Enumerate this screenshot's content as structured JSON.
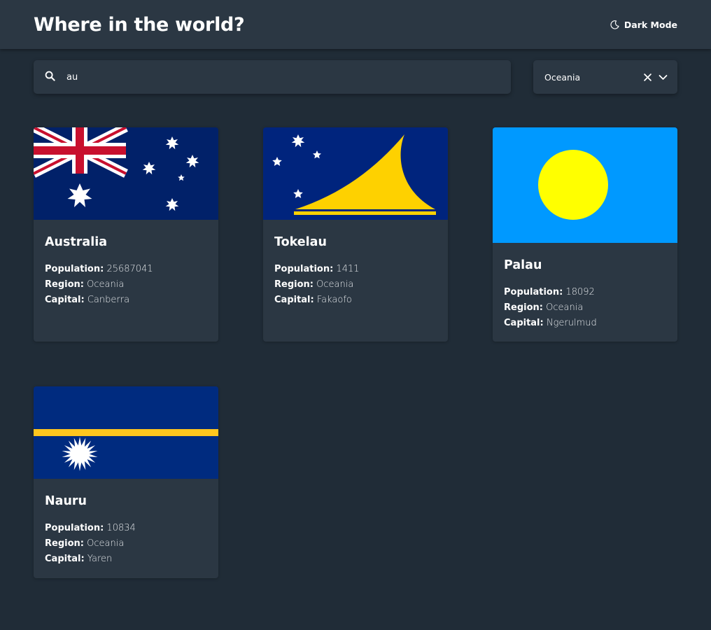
{
  "header": {
    "title": "Where in the world?",
    "theme_toggle_label": "Dark Mode",
    "theme_icon": "moon-icon"
  },
  "search": {
    "value": "au",
    "icon": "search-icon"
  },
  "filter": {
    "selected": "Oceania",
    "clear_icon": "close-icon",
    "chevron_icon": "chevron-down-icon"
  },
  "labels": {
    "population": "Population:",
    "region": "Region:",
    "capital": "Capital:"
  },
  "countries": [
    {
      "name": "Australia",
      "population": "25687041",
      "region": "Oceania",
      "capital": "Canberra",
      "flag": "australia-flag"
    },
    {
      "name": "Tokelau",
      "population": "1411",
      "region": "Oceania",
      "capital": "Fakaofo",
      "flag": "tokelau-flag"
    },
    {
      "name": "Palau",
      "population": "18092",
      "region": "Oceania",
      "capital": "Ngerulmud",
      "flag": "palau-flag"
    },
    {
      "name": "Nauru",
      "population": "10834",
      "region": "Oceania",
      "capital": "Yaren",
      "flag": "nauru-flag"
    }
  ],
  "colors": {
    "background": "#202c37",
    "element": "#2b3743",
    "text": "#ffffff"
  }
}
